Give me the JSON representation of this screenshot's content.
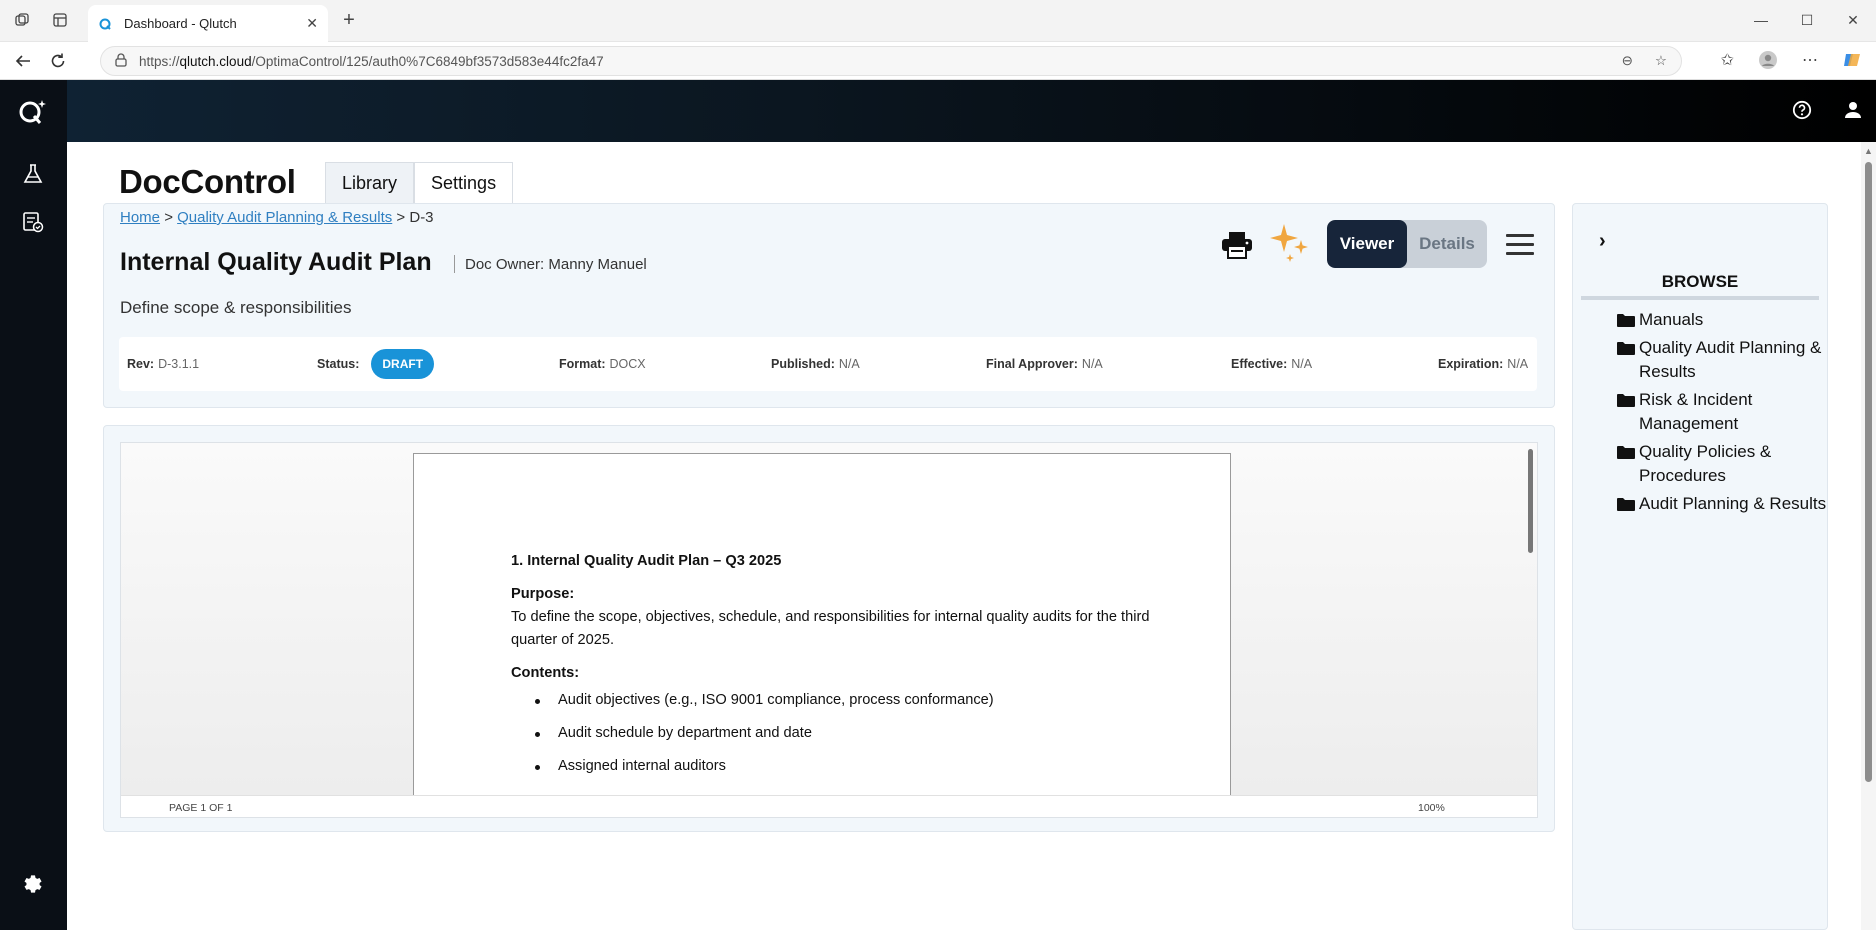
{
  "browser": {
    "tab_title": "Dashboard - Qlutch",
    "url_prefix": "https://",
    "url_domain": "qlutch.cloud",
    "url_path": "/OptimaControl/125/auth0%7C6849bf3573d583e44fc2fa47"
  },
  "app": {
    "name": "DocControl",
    "tabs": [
      {
        "label": "Library",
        "active": true
      },
      {
        "label": "Settings",
        "active": false
      }
    ]
  },
  "breadcrumb": {
    "home": "Home",
    "parent": "Quality Audit Planning & Results",
    "sep": ">",
    "current": "D-3"
  },
  "document": {
    "title": "Internal Quality Audit Plan",
    "owner": "Doc Owner: Manny Manuel",
    "description": "Define scope & responsibilities"
  },
  "view_toggle": {
    "viewer": "Viewer",
    "details": "Details",
    "active": "Viewer"
  },
  "meta": {
    "rev_label": "Rev:",
    "rev": "D-3.1.1",
    "status_label": "Status:",
    "status": "DRAFT",
    "format_label": "Format:",
    "format": "DOCX",
    "published_label": "Published:",
    "published": "N/A",
    "approver_label": "Final Approver:",
    "approver": "N/A",
    "effective_label": "Effective:",
    "effective": "N/A",
    "expiration_label": "Expiration:",
    "expiration": "N/A"
  },
  "doc_content": {
    "heading": "1. Internal Quality Audit Plan – Q3 2025",
    "purpose_label": "Purpose:",
    "purpose_text": "To define the scope, objectives, schedule, and responsibilities for internal quality audits for the third quarter of 2025.",
    "contents_label": "Contents:",
    "items": [
      "Audit objectives (e.g., ISO 9001 compliance, process conformance)",
      "Audit schedule by department and date",
      "Assigned internal auditors"
    ]
  },
  "viewer_footer": {
    "page": "PAGE 1 OF 1",
    "zoom": "100%"
  },
  "browse": {
    "title": "BROWSE",
    "folders": [
      "Manuals",
      "Quality Audit Planning & Results",
      "Risk & Incident Management",
      "Quality Policies & Procedures",
      "Audit Planning & Results"
    ]
  },
  "colors": {
    "accent": "#1993d8",
    "sidebar": "#0a0f16",
    "viewer_active": "#17253a",
    "spark": "#f0a640"
  }
}
